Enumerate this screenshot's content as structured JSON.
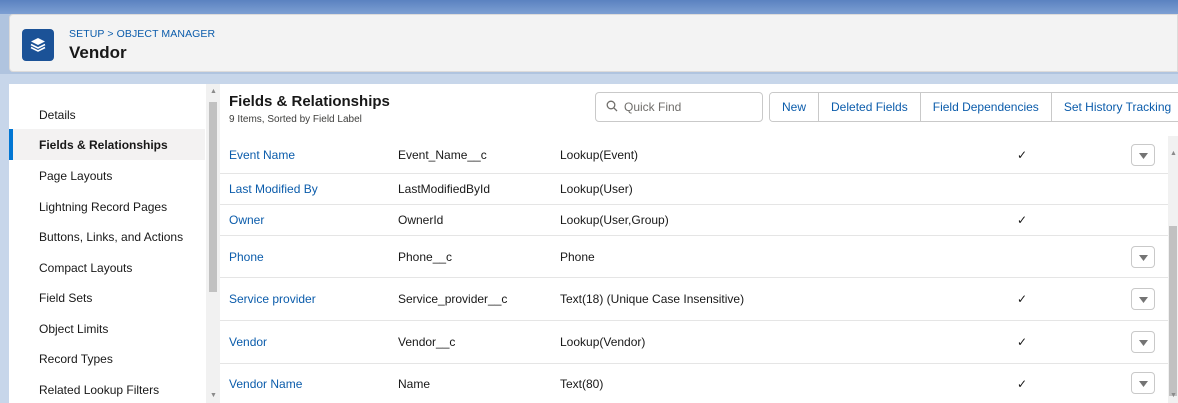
{
  "header": {
    "breadcrumb": "SETUP > OBJECT MANAGER",
    "title": "Vendor",
    "icon": "layers-icon",
    "icon_color": "#1b5297"
  },
  "sidebar": {
    "items": [
      {
        "label": "Details",
        "active": false
      },
      {
        "label": "Fields & Relationships",
        "active": true
      },
      {
        "label": "Page Layouts",
        "active": false
      },
      {
        "label": "Lightning Record Pages",
        "active": false
      },
      {
        "label": "Buttons, Links, and Actions",
        "active": false
      },
      {
        "label": "Compact Layouts",
        "active": false
      },
      {
        "label": "Field Sets",
        "active": false
      },
      {
        "label": "Object Limits",
        "active": false
      },
      {
        "label": "Record Types",
        "active": false
      },
      {
        "label": "Related Lookup Filters",
        "active": false
      }
    ]
  },
  "main": {
    "title": "Fields & Relationships",
    "subtitle": "9 Items, Sorted by Field Label",
    "search": {
      "placeholder": "Quick Find",
      "value": ""
    },
    "buttons": {
      "new": "New",
      "deleted_fields": "Deleted Fields",
      "field_dependencies": "Field Dependencies",
      "history_tracking": "Set History Tracking"
    },
    "rows": [
      {
        "label": "Event Name",
        "api": "Event_Name__c",
        "type": "Lookup(Event)",
        "indexed": "✓",
        "menu": true
      },
      {
        "label": "Last Modified By",
        "api": "LastModifiedById",
        "type": "Lookup(User)",
        "indexed": "",
        "menu": false
      },
      {
        "label": "Owner",
        "api": "OwnerId",
        "type": "Lookup(User,Group)",
        "indexed": "✓",
        "menu": false
      },
      {
        "label": "Phone",
        "api": "Phone__c",
        "type": "Phone",
        "indexed": "",
        "menu": true
      },
      {
        "label": "Service provider",
        "api": "Service_provider__c",
        "type": "Text(18) (Unique Case Insensitive)",
        "indexed": "✓",
        "menu": true
      },
      {
        "label": "Vendor",
        "api": "Vendor__c",
        "type": "Lookup(Vendor)",
        "indexed": "✓",
        "menu": true
      },
      {
        "label": "Vendor Name",
        "api": "Name",
        "type": "Text(80)",
        "indexed": "✓",
        "menu": true
      }
    ]
  },
  "colors": {
    "link": "#0b5cab",
    "active_bar": "#0176d3",
    "background_band": "#5b82c0"
  }
}
